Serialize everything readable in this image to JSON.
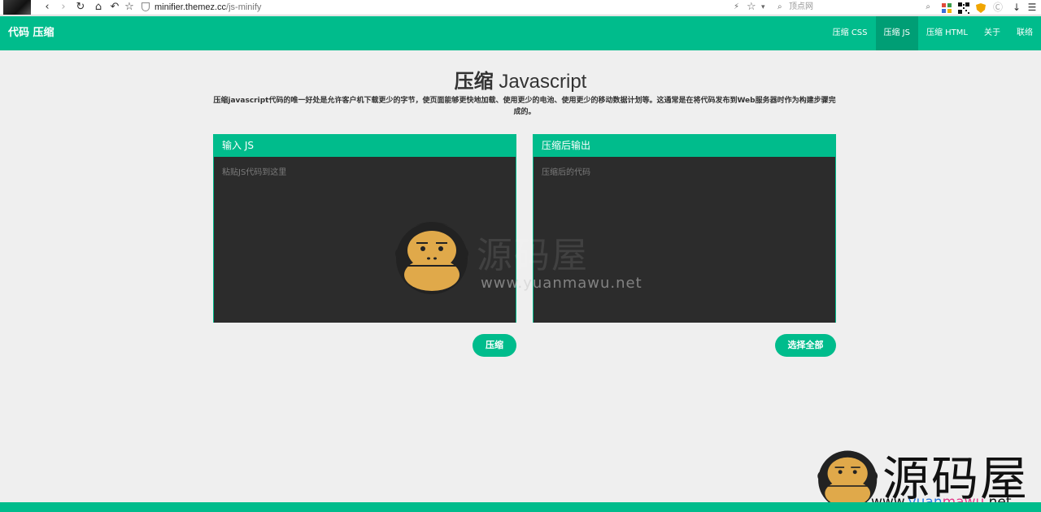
{
  "browser": {
    "url_host": "minifier.themez.cc",
    "url_path": "/js-minify",
    "search_placeholder": "顶点网"
  },
  "site": {
    "brand": "代码 压缩",
    "menu": [
      {
        "label": "压缩 CSS",
        "active": false
      },
      {
        "label": "压缩 JS",
        "active": true
      },
      {
        "label": "压缩 HTML",
        "active": false
      },
      {
        "label": "关于",
        "active": false
      },
      {
        "label": "联络",
        "active": false
      }
    ]
  },
  "main": {
    "title_cn": "压缩",
    "title_en": "Javascript",
    "description": "压缩javascript代码的唯一好处是允许客户机下载更少的字节，使页面能够更快地加载、使用更少的电池、使用更少的移动数据计划等。这通常是在将代码发布到Web服务器时作为构建步骤完成的。",
    "input_panel": {
      "title": "输入 JS",
      "placeholder": "粘贴JS代码到这里"
    },
    "output_panel": {
      "title": "压缩后输出",
      "placeholder": "压缩后的代码"
    },
    "minify_button": "压缩",
    "select_all_button": "选择全部"
  },
  "watermark": {
    "cn": "源码屋",
    "en": "www.yuanmawu.net",
    "en_a": "www.",
    "en_b": "yuan",
    "en_c": "mawu",
    "en_d": ".net"
  },
  "colors": {
    "accent": "#00bc8c",
    "accent_dark": "#009e75",
    "panel_bg": "#2c2c2c",
    "page_bg": "#efefef"
  }
}
